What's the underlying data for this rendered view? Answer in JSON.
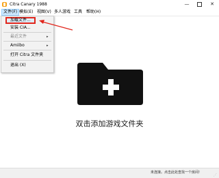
{
  "window": {
    "title": "Citra Canary 1988",
    "minimize_glyph": "—",
    "close_glyph": "✕"
  },
  "menubar": {
    "items": [
      {
        "label": "文件(F)"
      },
      {
        "label": "模拟(E)"
      },
      {
        "label": "视图(V)"
      },
      {
        "label": "多人游戏"
      },
      {
        "label": "工具"
      },
      {
        "label": "帮助(H)"
      }
    ]
  },
  "file_menu": {
    "items": [
      {
        "label": "加载文件..."
      },
      {
        "label": "安装 CIA..."
      },
      {
        "label": "最近文件"
      },
      {
        "label": "Amiibo"
      },
      {
        "label": "打开 Citra 文件夹"
      },
      {
        "label": "退出 (X)"
      }
    ],
    "submenu_arrow": "▸"
  },
  "main": {
    "drop_label": "双击添加游戏文件夹"
  },
  "statusbar": {
    "text": "未连接。点击此处查找一个房间!",
    "grip": "⋰"
  },
  "colors": {
    "highlight_red": "#e1251b",
    "menu_active": "#cce8ff",
    "folder_black": "#111111"
  }
}
